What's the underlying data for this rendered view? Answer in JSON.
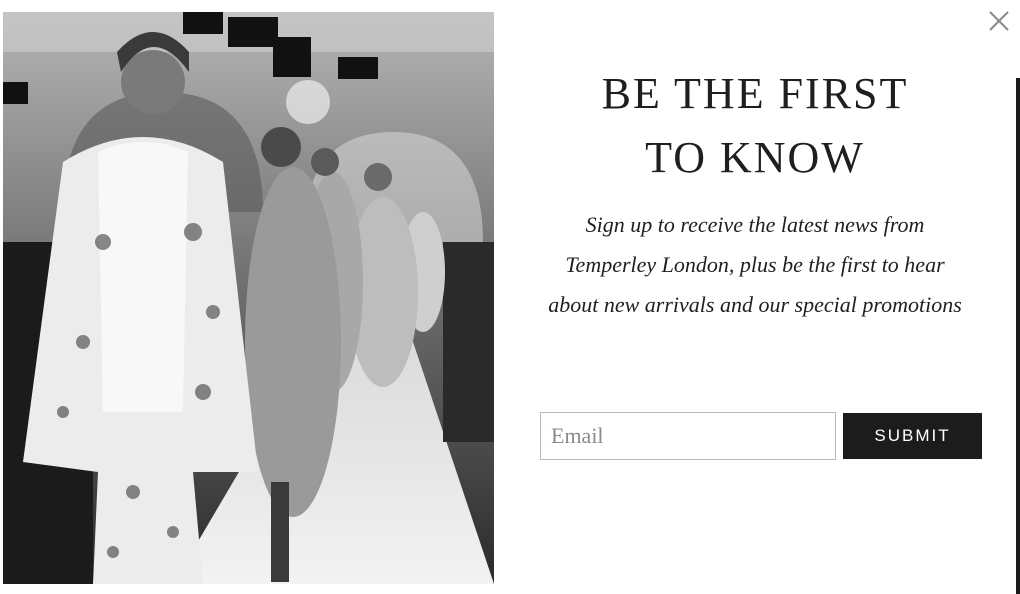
{
  "popup": {
    "headline_line1": "BE THE FIRST",
    "headline_line2": "TO KNOW",
    "subtext": "Sign up to receive the latest news from Temperley London, plus be the first to hear about new arrivals and our special promotions",
    "email_placeholder": "Email",
    "email_value": "",
    "submit_label": "SUBMIT",
    "close_icon": "close-icon",
    "image_description_icon": "runway-photo"
  }
}
